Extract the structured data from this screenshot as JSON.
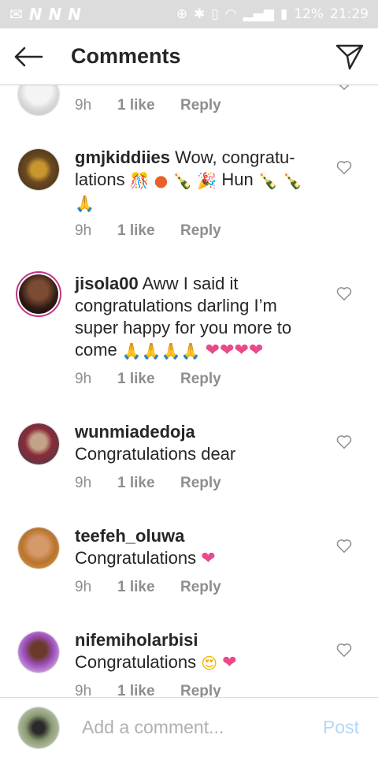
{
  "status_bar": {
    "network_glyphs": [
      "N",
      "N",
      "N"
    ],
    "battery": "12%",
    "time": "21:29"
  },
  "header": {
    "title": "Comments",
    "back_icon": "arrow-left-icon",
    "send_icon": "paper-plane-icon"
  },
  "comments": [
    {
      "username": "",
      "text": "",
      "time": "9h",
      "likes": "1 like",
      "reply": "Reply"
    },
    {
      "username": "gmjkiddiies",
      "text": "Wow, congratu-lations",
      "text_line1": "Wow, congratu-",
      "text_line2": "lations",
      "text_suffix": "Hun",
      "time": "9h",
      "likes": "1 like",
      "reply": "Reply"
    },
    {
      "username": "jisola00",
      "text_line1": "Aww I said it",
      "text_line2": "congratulations darling I’m",
      "text_line3": "super happy for you more to",
      "text_line4": "come",
      "time": "9h",
      "likes": "1 like",
      "reply": "Reply"
    },
    {
      "username": "wunmiadedoja",
      "text": "Congratulations dear",
      "time": "9h",
      "likes": "1 like",
      "reply": "Reply"
    },
    {
      "username": "teefeh_oluwa",
      "text": "Congratulations",
      "time": "9h",
      "likes": "1 like",
      "reply": "Reply"
    },
    {
      "username": "nifemiholarbisi",
      "text": "Congratulations",
      "time": "9h",
      "likes": "1 like",
      "reply": "Reply"
    }
  ],
  "composer": {
    "placeholder": "Add a comment...",
    "post_label": "Post"
  },
  "colors": {
    "post_disabled": "#b3d7f7",
    "meta_gray": "#8e8e8e",
    "heart_pink": "#e84a8a"
  }
}
